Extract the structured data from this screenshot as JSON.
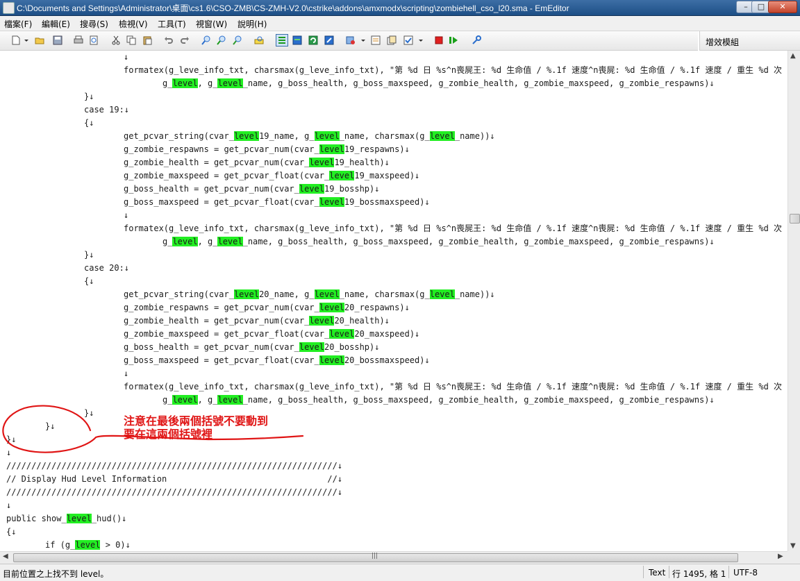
{
  "window": {
    "title": "C:\\Documents and Settings\\Administrator\\桌面\\cs1.6\\CSO-ZMB\\CS-ZMH-V2.0\\cstrike\\addons\\amxmodx\\scripting\\zombiehell_cso_l20.sma - EmEditor",
    "minimize": "–",
    "maximize": "□",
    "close": "✕"
  },
  "menu": [
    "檔案(F)",
    "編輯(E)",
    "搜尋(S)",
    "檢視(V)",
    "工具(T)",
    "視窗(W)",
    "說明(H)"
  ],
  "plugin_bar": {
    "label": "增效模組"
  },
  "highlight_color": "#22ee22",
  "code_lines": [
    [
      "↓"
    ],
    [
      "formatex(g_leve_info_txt, charsmax(g_leve_info_txt), \"第 %d 日 %s^n喪屍王: %d 生命值 / %.1f 速度^n喪屍: %d 生命值 / %.1f 速度 / 重生 %d 次"
    ],
    [
      "g_",
      "level",
      ", g_",
      "level",
      "_name, g_boss_health, g_boss_maxspeed, g_zombie_health, g_zombie_maxspeed, g_zombie_respawns)↓"
    ],
    [
      "}↓"
    ],
    [
      "case 19:↓"
    ],
    [
      "{↓"
    ],
    [
      "get_pcvar_string(cvar_",
      "level",
      "19_name, g_",
      "level",
      "_name, charsmax(g_",
      "level",
      "_name))↓"
    ],
    [
      "g_zombie_respawns = get_pcvar_num(cvar_",
      "level",
      "19_respawns)↓"
    ],
    [
      "g_zombie_health = get_pcvar_num(cvar_",
      "level",
      "19_health)↓"
    ],
    [
      "g_zombie_maxspeed = get_pcvar_float(cvar_",
      "level",
      "19_maxspeed)↓"
    ],
    [
      "g_boss_health = get_pcvar_num(cvar_",
      "level",
      "19_bosshp)↓"
    ],
    [
      "g_boss_maxspeed = get_pcvar_float(cvar_",
      "level",
      "19_bossmaxspeed)↓"
    ],
    [
      "↓"
    ],
    [
      "formatex(g_leve_info_txt, charsmax(g_leve_info_txt), \"第 %d 日 %s^n喪屍王: %d 生命值 / %.1f 速度^n喪屍: %d 生命值 / %.1f 速度 / 重生 %d 次"
    ],
    [
      "g_",
      "level",
      ", g_",
      "level",
      "_name, g_boss_health, g_boss_maxspeed, g_zombie_health, g_zombie_maxspeed, g_zombie_respawns)↓"
    ],
    [
      "}↓"
    ],
    [
      "case 20:↓"
    ],
    [
      "{↓"
    ],
    [
      "get_pcvar_string(cvar_",
      "level",
      "20_name, g_",
      "level",
      "_name, charsmax(g_",
      "level",
      "_name))↓"
    ],
    [
      "g_zombie_respawns = get_pcvar_num(cvar_",
      "level",
      "20_respawns)↓"
    ],
    [
      "g_zombie_health = get_pcvar_num(cvar_",
      "level",
      "20_health)↓"
    ],
    [
      "g_zombie_maxspeed = get_pcvar_float(cvar_",
      "level",
      "20_maxspeed)↓"
    ],
    [
      "g_boss_health = get_pcvar_num(cvar_",
      "level",
      "20_bosshp)↓"
    ],
    [
      "g_boss_maxspeed = get_pcvar_float(cvar_",
      "level",
      "20_bossmaxspeed)↓"
    ],
    [
      "↓"
    ],
    [
      "formatex(g_leve_info_txt, charsmax(g_leve_info_txt), \"第 %d 日 %s^n喪屍王: %d 生命值 / %.1f 速度^n喪屍: %d 生命值 / %.1f 速度 / 重生 %d 次"
    ],
    [
      "g_",
      "level",
      ", g_",
      "level",
      "_name, g_boss_health, g_boss_maxspeed, g_zombie_health, g_zombie_maxspeed, g_zombie_respawns)↓"
    ],
    [
      "}↓"
    ],
    [
      "}↓"
    ],
    [
      "}↓"
    ],
    [
      "↓"
    ],
    [
      "//////////////////////////////////////////////////////////////////↓"
    ],
    [
      "// Display Hud Level Information                                //↓"
    ],
    [
      "//////////////////////////////////////////////////////////////////↓"
    ],
    [
      "↓"
    ],
    [
      "public show_",
      "level",
      "_hud()↓"
    ],
    [
      "{↓"
    ],
    [
      "if (g_",
      "level",
      " > 0)↓"
    ]
  ],
  "annotation": {
    "line1": "注意在最後兩個括號不要動到",
    "line2": "要在這兩個括號裡",
    "color": "#e01515"
  },
  "status": {
    "message": "目前位置之上找不到 level。",
    "mode": "Text",
    "position": "行 1495, 格 1",
    "encoding": "UTF-8"
  }
}
